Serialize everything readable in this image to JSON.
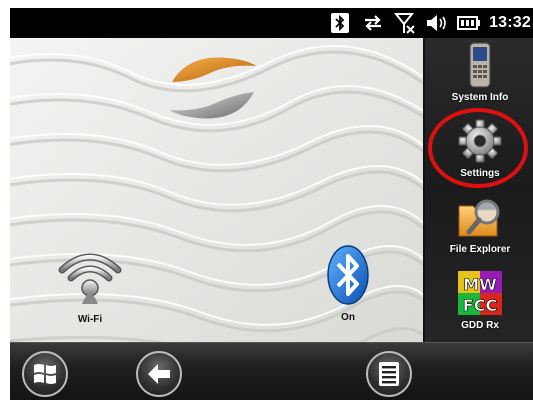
{
  "status_bar": {
    "time": "13:32",
    "icons": [
      "bluetooth-icon",
      "sync-icon",
      "no-signal-icon",
      "volume-icon",
      "battery-icon"
    ]
  },
  "desktop": {
    "logo": "company-logo",
    "items": [
      {
        "label": "Wi-Fi",
        "icon": "wifi-icon"
      },
      {
        "label": "On",
        "icon": "bluetooth-icon"
      }
    ]
  },
  "launcher": {
    "items": [
      {
        "label": "System Info",
        "icon": "device-icon"
      },
      {
        "label": "Settings",
        "icon": "gear-icon"
      },
      {
        "label": "File Explorer",
        "icon": "folder-search-icon"
      },
      {
        "label": "GDD Rx",
        "icon": "app-logo-icon"
      }
    ],
    "highlight_color": "#e01010"
  },
  "bottom_bar": {
    "buttons": [
      "start-icon",
      "back-icon",
      "menu-icon"
    ]
  },
  "colors": {
    "bar_bg": "#000000",
    "sand": "#e6e6e4",
    "bluetooth_blue": "#1a6fd6",
    "logo_orange": "#d9821e"
  }
}
